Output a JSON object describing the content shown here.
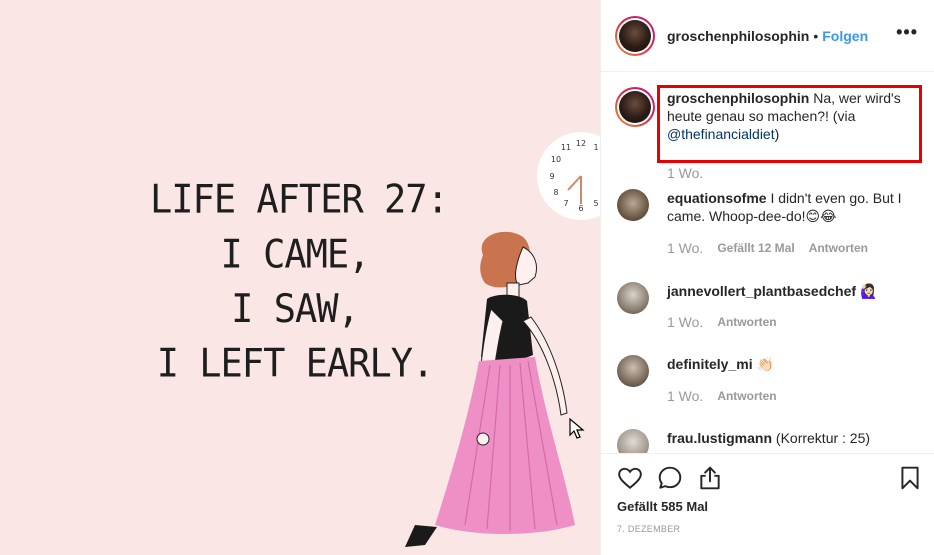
{
  "post_image": {
    "text_lines": [
      "LIFE AFTER 27:",
      "I CAME,",
      "I SAW,",
      "I LEFT EARLY."
    ]
  },
  "header": {
    "username": "groschenphilosophin",
    "separator": "•",
    "follow_label": "Folgen",
    "more_icon": "more-options-icon",
    "more_glyph": "•••"
  },
  "caption": {
    "username": "groschenphilosophin",
    "text": "Na, wer wird's heute genau so machen?! (via ",
    "mention": "@thefinancialdiet",
    "text_end": ")",
    "time": "1 Wo."
  },
  "comments": [
    {
      "username": "equationsofme",
      "text": "I didn't even go. But I came. Whoop-dee-do!😊😂",
      "time": "1 Wo.",
      "likes": "Gefällt 12 Mal",
      "reply": "Antworten"
    },
    {
      "username": "jannevollert_plantbasedchef",
      "text": "🙋🏻‍♀️",
      "time": "1 Wo.",
      "reply": "Antworten"
    },
    {
      "username": "definitely_mi",
      "text": "👏🏻",
      "time": "1 Wo.",
      "reply": "Antworten"
    },
    {
      "username": "frau.lustigmann",
      "text": "(Korrektur : 25)"
    }
  ],
  "actions": {
    "like_icon": "heart-icon",
    "comment_icon": "comment-icon",
    "share_icon": "share-icon",
    "save_icon": "bookmark-icon",
    "likes_text": "Gefällt 585 Mal",
    "date_text": "7. DEZEMBER"
  },
  "colors": {
    "accent": "#3897f0",
    "highlight": "#e60000",
    "image_bg": "#f9e6e5",
    "skirt": "#ee8fc5",
    "hair": "#c9734f"
  }
}
